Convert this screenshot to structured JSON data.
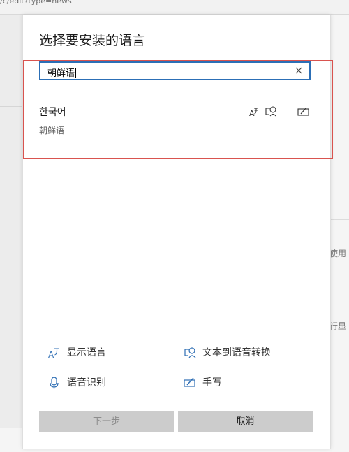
{
  "background": {
    "url_fragment": "/c/edit?type=news",
    "right_text_1": "使用",
    "right_text_2": "行显"
  },
  "dialog": {
    "title": "选择要安装的语言",
    "search": {
      "value": "朝鲜语"
    },
    "result": {
      "native_name": "한국어",
      "local_name": "朝鲜语",
      "feature_icons": [
        "display-language-icon",
        "text-to-speech-icon",
        "handwriting-icon"
      ]
    },
    "legend": [
      {
        "icon": "display-language-icon",
        "label": "显示语言"
      },
      {
        "icon": "text-to-speech-icon",
        "label": "文本到语音转换"
      },
      {
        "icon": "microphone-icon",
        "label": "语音识别"
      },
      {
        "icon": "handwriting-icon",
        "label": "手写"
      }
    ],
    "buttons": {
      "next": "下一步",
      "cancel": "取消"
    }
  },
  "colors": {
    "accent": "#2c6fb6",
    "icon_blue": "#2f6fb5",
    "highlight": "#d9534f",
    "button_bg": "#cccccc",
    "disabled_text": "#8c8c8c"
  }
}
